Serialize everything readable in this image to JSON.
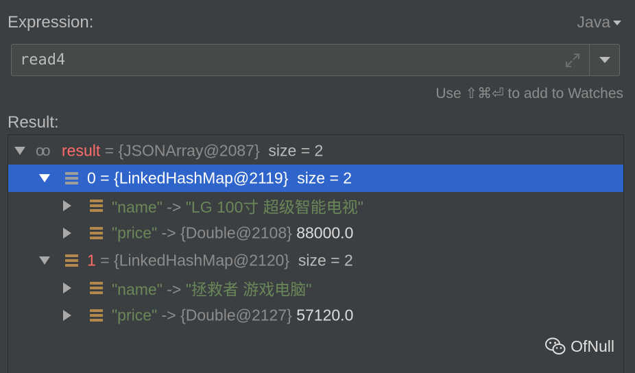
{
  "header": {
    "expression_label": "Expression:",
    "language": "Java"
  },
  "expression": {
    "value": "read4"
  },
  "hint": "Use ⇧⌘⏎ to add to Watches",
  "result_label": "Result:",
  "tree": {
    "root": {
      "name": "result",
      "eq": " = ",
      "ref": "{JSONArray@2087}",
      "size": "size = 2"
    },
    "items": [
      {
        "name": "0",
        "eq": " = ",
        "ref": "{LinkedHashMap@2119}",
        "size": "size = 2",
        "children": [
          {
            "key": "\"name\"",
            "arrow": " -> ",
            "value": "\"LG 100寸 超级智能电视\""
          },
          {
            "key": "\"price\"",
            "arrow": " -> ",
            "ref": "{Double@2108}",
            "value": "88000.0"
          }
        ]
      },
      {
        "name": "1",
        "eq": " = ",
        "ref": "{LinkedHashMap@2120}",
        "size": "size = 2",
        "children": [
          {
            "key": "\"name\"",
            "arrow": " -> ",
            "value": "\"拯救者 游戏电脑\""
          },
          {
            "key": "\"price\"",
            "arrow": " -> ",
            "ref": "{Double@2127}",
            "value": "57120.0"
          }
        ]
      }
    ]
  },
  "watermark": "OfNull",
  "colors": {
    "background": "#3c3f41",
    "selection": "#2f65ca",
    "string": "#6a8759",
    "name_red": "#ff6b68",
    "map_icon": "#b3884a"
  }
}
